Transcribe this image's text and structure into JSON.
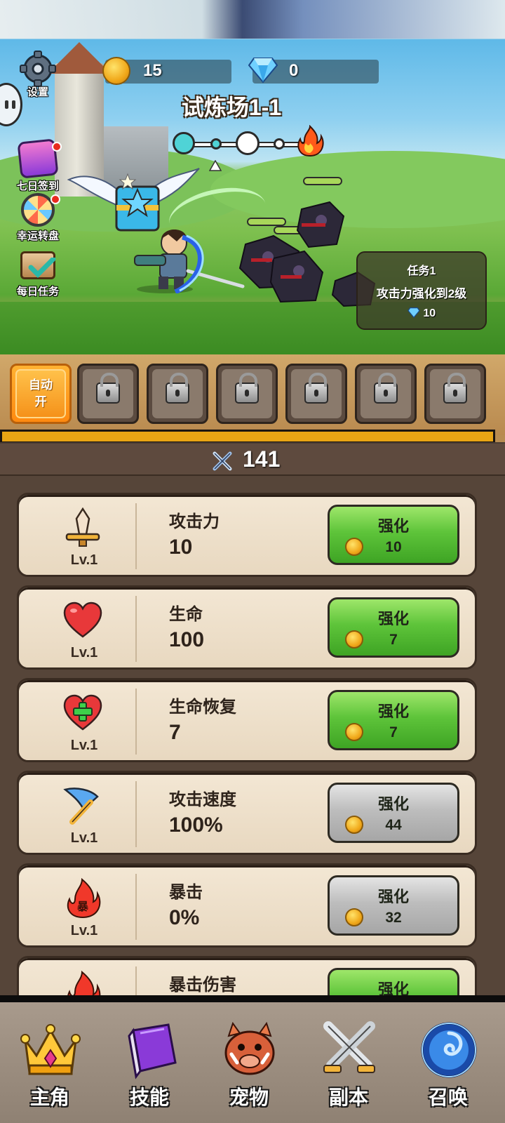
{
  "resources": {
    "coins": "15",
    "gems": "0"
  },
  "side_menu": {
    "settings_label": "设置",
    "seven_day_label": "七日签到",
    "lucky_wheel_label": "幸运转盘",
    "daily_task_label": "每日任务"
  },
  "stage": {
    "title": "试炼场1-1"
  },
  "quest": {
    "title": "任务1",
    "desc": "攻击力强化到2级",
    "reward": "10"
  },
  "skill_bar": {
    "auto_line1": "自动",
    "auto_line2": "开",
    "locked_slots": 6
  },
  "power": {
    "value": "141"
  },
  "upgrades": [
    {
      "name": "攻击力",
      "value": "10",
      "level": "Lv.1",
      "button_label": "强化",
      "cost": "10",
      "affordable": true,
      "icon": "sword-icon"
    },
    {
      "name": "生命",
      "value": "100",
      "level": "Lv.1",
      "button_label": "强化",
      "cost": "7",
      "affordable": true,
      "icon": "heart-icon"
    },
    {
      "name": "生命恢复",
      "value": "7",
      "level": "Lv.1",
      "button_label": "强化",
      "cost": "7",
      "affordable": true,
      "icon": "heart-plus-icon"
    },
    {
      "name": "攻击速度",
      "value": "100%",
      "level": "Lv.1",
      "button_label": "强化",
      "cost": "44",
      "affordable": false,
      "icon": "axe-icon"
    },
    {
      "name": "暴击",
      "value": "0%",
      "level": "Lv.1",
      "button_label": "强化",
      "cost": "32",
      "affordable": false,
      "icon": "crit-fire-icon",
      "icon_text": "暴"
    },
    {
      "name": "暴击伤害",
      "button_label": "强化",
      "affordable": true,
      "icon": "crit-damage-fire-icon"
    }
  ],
  "nav": [
    {
      "label": "主角",
      "icon": "crown-icon"
    },
    {
      "label": "技能",
      "icon": "spellbook-icon"
    },
    {
      "label": "宠物",
      "icon": "boar-icon"
    },
    {
      "label": "副本",
      "icon": "crossed-swords-icon"
    },
    {
      "label": "召唤",
      "icon": "summon-portal-icon"
    }
  ],
  "colors": {
    "green_button": "#5ec43a",
    "gray_button": "#bdbdbd",
    "xp_bar": "#e8a414",
    "auto_button": "#ff9a1e"
  }
}
